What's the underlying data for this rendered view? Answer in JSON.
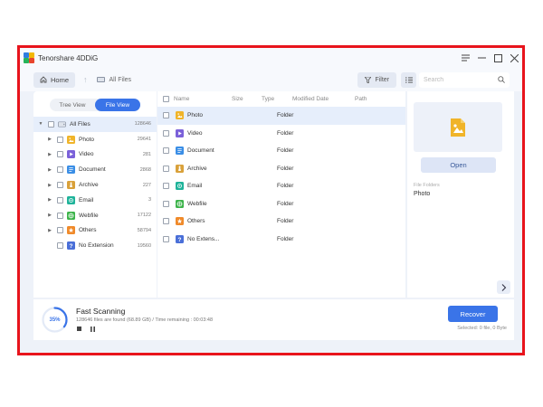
{
  "window": {
    "title": "Tenorshare 4DDiG",
    "controls": [
      "menu-icon",
      "minimize-icon",
      "maximize-icon",
      "close-icon"
    ]
  },
  "toolbar": {
    "home_label": "Home",
    "breadcrumb": "All Files",
    "filter_label": "Filter",
    "search_placeholder": "Search"
  },
  "left": {
    "tabs": [
      {
        "label": "Tree View",
        "active": false
      },
      {
        "label": "File View",
        "active": true
      }
    ],
    "tree": [
      {
        "label": "All Files",
        "count": "128646",
        "icon": "drive-icon",
        "color": "#8a93a3",
        "root": true
      },
      {
        "label": "Photo",
        "count": "29641",
        "icon": "photo-icon",
        "color": "#f0b429"
      },
      {
        "label": "Video",
        "count": "281",
        "icon": "video-icon",
        "color": "#7b61d9"
      },
      {
        "label": "Document",
        "count": "2868",
        "icon": "document-icon",
        "color": "#3a8ee6"
      },
      {
        "label": "Archive",
        "count": "227",
        "icon": "archive-icon",
        "color": "#d9a13a"
      },
      {
        "label": "Email",
        "count": "3",
        "icon": "email-icon",
        "color": "#1fb39a"
      },
      {
        "label": "Webfile",
        "count": "17122",
        "icon": "webfile-icon",
        "color": "#3cb34a"
      },
      {
        "label": "Others",
        "count": "58794",
        "icon": "others-icon",
        "color": "#f08a2a"
      },
      {
        "label": "No Extension",
        "count": "19560",
        "icon": "no-extension-icon",
        "color": "#4a6fd8"
      }
    ]
  },
  "center": {
    "headers": {
      "name": "Name",
      "size": "Size",
      "type": "Type",
      "modified": "Modified Date",
      "path": "Path"
    },
    "rows": [
      {
        "name": "Photo",
        "type": "Folder",
        "icon": "photo-icon",
        "color": "#f0b429"
      },
      {
        "name": "Video",
        "type": "Folder",
        "icon": "video-icon",
        "color": "#7b61d9"
      },
      {
        "name": "Document",
        "type": "Folder",
        "icon": "document-icon",
        "color": "#3a8ee6"
      },
      {
        "name": "Archive",
        "type": "Folder",
        "icon": "archive-icon",
        "color": "#d9a13a"
      },
      {
        "name": "Email",
        "type": "Folder",
        "icon": "email-icon",
        "color": "#1fb39a"
      },
      {
        "name": "Webfile",
        "type": "Folder",
        "icon": "webfile-icon",
        "color": "#3cb34a"
      },
      {
        "name": "Others",
        "type": "Folder",
        "icon": "others-icon",
        "color": "#f08a2a"
      },
      {
        "name": "No Extens...",
        "type": "Folder",
        "icon": "no-extension-icon",
        "color": "#4a6fd8"
      }
    ]
  },
  "right": {
    "open_label": "Open",
    "folder_label": "File Folders",
    "folder_value": "Photo"
  },
  "bottom": {
    "progress": 35,
    "progress_label": "35%",
    "scan_title": "Fast Scanning",
    "scan_detail": "128646 files are found (68.89 GB) / Time remaining : 00:03:48",
    "recover_label": "Recover",
    "selected_info": "Selected: 0 file, 0 Byte"
  },
  "colors": {
    "accent": "#3a74e8",
    "frame": "#e8141c"
  }
}
